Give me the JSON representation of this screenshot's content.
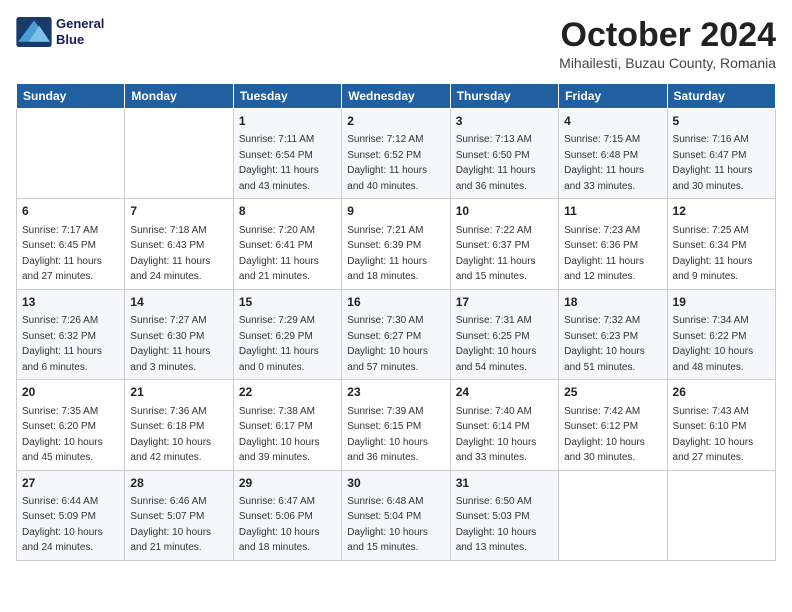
{
  "logo": {
    "line1": "General",
    "line2": "Blue"
  },
  "title": "October 2024",
  "location": "Mihailesti, Buzau County, Romania",
  "weekdays": [
    "Sunday",
    "Monday",
    "Tuesday",
    "Wednesday",
    "Thursday",
    "Friday",
    "Saturday"
  ],
  "weeks": [
    [
      {
        "day": "",
        "sunrise": "",
        "sunset": "",
        "daylight": ""
      },
      {
        "day": "",
        "sunrise": "",
        "sunset": "",
        "daylight": ""
      },
      {
        "day": "1",
        "sunrise": "Sunrise: 7:11 AM",
        "sunset": "Sunset: 6:54 PM",
        "daylight": "Daylight: 11 hours and 43 minutes."
      },
      {
        "day": "2",
        "sunrise": "Sunrise: 7:12 AM",
        "sunset": "Sunset: 6:52 PM",
        "daylight": "Daylight: 11 hours and 40 minutes."
      },
      {
        "day": "3",
        "sunrise": "Sunrise: 7:13 AM",
        "sunset": "Sunset: 6:50 PM",
        "daylight": "Daylight: 11 hours and 36 minutes."
      },
      {
        "day": "4",
        "sunrise": "Sunrise: 7:15 AM",
        "sunset": "Sunset: 6:48 PM",
        "daylight": "Daylight: 11 hours and 33 minutes."
      },
      {
        "day": "5",
        "sunrise": "Sunrise: 7:16 AM",
        "sunset": "Sunset: 6:47 PM",
        "daylight": "Daylight: 11 hours and 30 minutes."
      }
    ],
    [
      {
        "day": "6",
        "sunrise": "Sunrise: 7:17 AM",
        "sunset": "Sunset: 6:45 PM",
        "daylight": "Daylight: 11 hours and 27 minutes."
      },
      {
        "day": "7",
        "sunrise": "Sunrise: 7:18 AM",
        "sunset": "Sunset: 6:43 PM",
        "daylight": "Daylight: 11 hours and 24 minutes."
      },
      {
        "day": "8",
        "sunrise": "Sunrise: 7:20 AM",
        "sunset": "Sunset: 6:41 PM",
        "daylight": "Daylight: 11 hours and 21 minutes."
      },
      {
        "day": "9",
        "sunrise": "Sunrise: 7:21 AM",
        "sunset": "Sunset: 6:39 PM",
        "daylight": "Daylight: 11 hours and 18 minutes."
      },
      {
        "day": "10",
        "sunrise": "Sunrise: 7:22 AM",
        "sunset": "Sunset: 6:37 PM",
        "daylight": "Daylight: 11 hours and 15 minutes."
      },
      {
        "day": "11",
        "sunrise": "Sunrise: 7:23 AM",
        "sunset": "Sunset: 6:36 PM",
        "daylight": "Daylight: 11 hours and 12 minutes."
      },
      {
        "day": "12",
        "sunrise": "Sunrise: 7:25 AM",
        "sunset": "Sunset: 6:34 PM",
        "daylight": "Daylight: 11 hours and 9 minutes."
      }
    ],
    [
      {
        "day": "13",
        "sunrise": "Sunrise: 7:26 AM",
        "sunset": "Sunset: 6:32 PM",
        "daylight": "Daylight: 11 hours and 6 minutes."
      },
      {
        "day": "14",
        "sunrise": "Sunrise: 7:27 AM",
        "sunset": "Sunset: 6:30 PM",
        "daylight": "Daylight: 11 hours and 3 minutes."
      },
      {
        "day": "15",
        "sunrise": "Sunrise: 7:29 AM",
        "sunset": "Sunset: 6:29 PM",
        "daylight": "Daylight: 11 hours and 0 minutes."
      },
      {
        "day": "16",
        "sunrise": "Sunrise: 7:30 AM",
        "sunset": "Sunset: 6:27 PM",
        "daylight": "Daylight: 10 hours and 57 minutes."
      },
      {
        "day": "17",
        "sunrise": "Sunrise: 7:31 AM",
        "sunset": "Sunset: 6:25 PM",
        "daylight": "Daylight: 10 hours and 54 minutes."
      },
      {
        "day": "18",
        "sunrise": "Sunrise: 7:32 AM",
        "sunset": "Sunset: 6:23 PM",
        "daylight": "Daylight: 10 hours and 51 minutes."
      },
      {
        "day": "19",
        "sunrise": "Sunrise: 7:34 AM",
        "sunset": "Sunset: 6:22 PM",
        "daylight": "Daylight: 10 hours and 48 minutes."
      }
    ],
    [
      {
        "day": "20",
        "sunrise": "Sunrise: 7:35 AM",
        "sunset": "Sunset: 6:20 PM",
        "daylight": "Daylight: 10 hours and 45 minutes."
      },
      {
        "day": "21",
        "sunrise": "Sunrise: 7:36 AM",
        "sunset": "Sunset: 6:18 PM",
        "daylight": "Daylight: 10 hours and 42 minutes."
      },
      {
        "day": "22",
        "sunrise": "Sunrise: 7:38 AM",
        "sunset": "Sunset: 6:17 PM",
        "daylight": "Daylight: 10 hours and 39 minutes."
      },
      {
        "day": "23",
        "sunrise": "Sunrise: 7:39 AM",
        "sunset": "Sunset: 6:15 PM",
        "daylight": "Daylight: 10 hours and 36 minutes."
      },
      {
        "day": "24",
        "sunrise": "Sunrise: 7:40 AM",
        "sunset": "Sunset: 6:14 PM",
        "daylight": "Daylight: 10 hours and 33 minutes."
      },
      {
        "day": "25",
        "sunrise": "Sunrise: 7:42 AM",
        "sunset": "Sunset: 6:12 PM",
        "daylight": "Daylight: 10 hours and 30 minutes."
      },
      {
        "day": "26",
        "sunrise": "Sunrise: 7:43 AM",
        "sunset": "Sunset: 6:10 PM",
        "daylight": "Daylight: 10 hours and 27 minutes."
      }
    ],
    [
      {
        "day": "27",
        "sunrise": "Sunrise: 6:44 AM",
        "sunset": "Sunset: 5:09 PM",
        "daylight": "Daylight: 10 hours and 24 minutes."
      },
      {
        "day": "28",
        "sunrise": "Sunrise: 6:46 AM",
        "sunset": "Sunset: 5:07 PM",
        "daylight": "Daylight: 10 hours and 21 minutes."
      },
      {
        "day": "29",
        "sunrise": "Sunrise: 6:47 AM",
        "sunset": "Sunset: 5:06 PM",
        "daylight": "Daylight: 10 hours and 18 minutes."
      },
      {
        "day": "30",
        "sunrise": "Sunrise: 6:48 AM",
        "sunset": "Sunset: 5:04 PM",
        "daylight": "Daylight: 10 hours and 15 minutes."
      },
      {
        "day": "31",
        "sunrise": "Sunrise: 6:50 AM",
        "sunset": "Sunset: 5:03 PM",
        "daylight": "Daylight: 10 hours and 13 minutes."
      },
      {
        "day": "",
        "sunrise": "",
        "sunset": "",
        "daylight": ""
      },
      {
        "day": "",
        "sunrise": "",
        "sunset": "",
        "daylight": ""
      }
    ]
  ]
}
